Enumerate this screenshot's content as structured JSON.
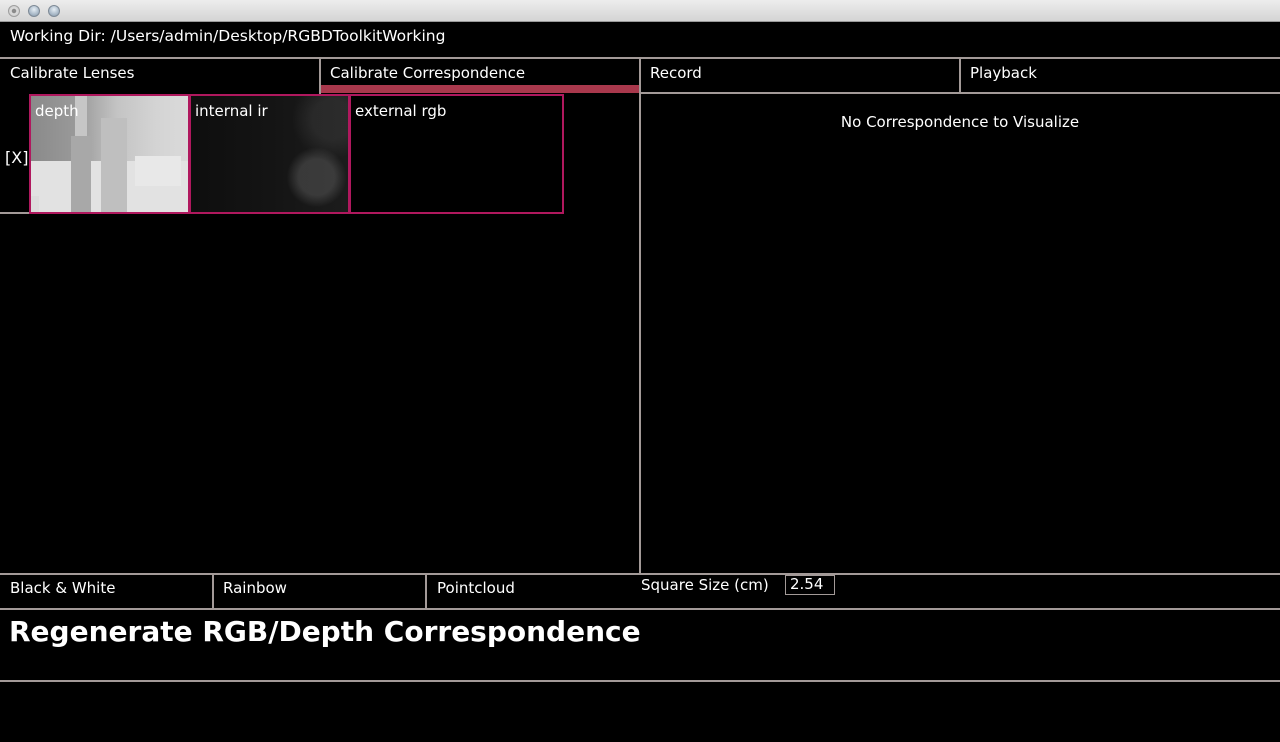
{
  "window": {
    "traffic_lights": [
      "close",
      "minimize",
      "zoom"
    ]
  },
  "header": {
    "working_dir_label": "Working Dir: /Users/admin/Desktop/RGBDToolkitWorking"
  },
  "tabs": [
    {
      "label": "Calibrate Lenses",
      "active": false
    },
    {
      "label": "Calibrate Correspondence",
      "active": true
    },
    {
      "label": "Record",
      "active": false
    },
    {
      "label": "Playback",
      "active": false
    }
  ],
  "accent_color": "#a8384c",
  "thumbnail_border_color": "#b0185e",
  "correspondence_row": {
    "delete_label": "[X]",
    "thumbnails": [
      {
        "label": "depth"
      },
      {
        "label": "internal ir"
      },
      {
        "label": "external rgb"
      }
    ]
  },
  "visualizer": {
    "empty_message": "No Correspondence to Visualize"
  },
  "render_modes": [
    {
      "label": "Black & White"
    },
    {
      "label": "Rainbow"
    },
    {
      "label": "Pointcloud"
    }
  ],
  "square_size": {
    "label": "Square Size (cm)",
    "value": "2.54"
  },
  "actions": {
    "regenerate_label": "Regenerate RGB/Depth Correspondence"
  }
}
